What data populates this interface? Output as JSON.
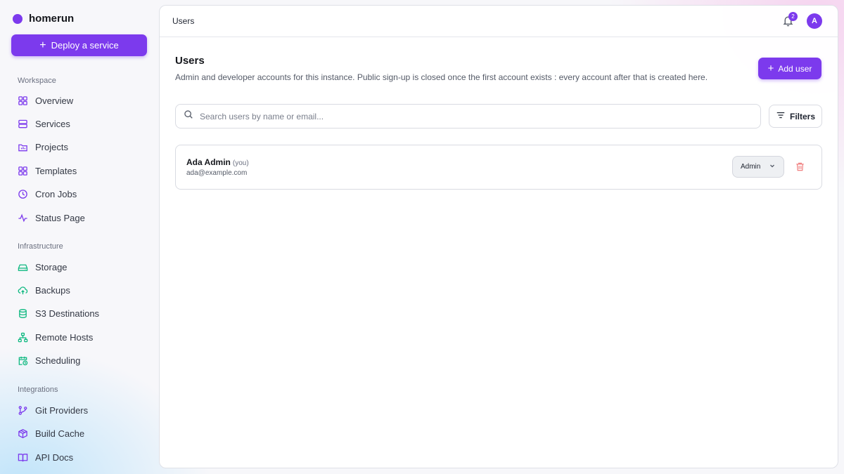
{
  "brand": {
    "name": "homerun",
    "accent": "#7c3aed"
  },
  "sidebar": {
    "deploy_label": "Deploy a service",
    "sections": [
      {
        "title": "Workspace",
        "items": [
          {
            "label": "Overview",
            "icon": "grid-icon"
          },
          {
            "label": "Services",
            "icon": "server-icon"
          },
          {
            "label": "Projects",
            "icon": "folder-icon"
          },
          {
            "label": "Templates",
            "icon": "template-grid-icon"
          },
          {
            "label": "Cron Jobs",
            "icon": "clock-icon"
          },
          {
            "label": "Status Page",
            "icon": "activity-icon"
          }
        ]
      },
      {
        "title": "Infrastructure",
        "items": [
          {
            "label": "Storage",
            "icon": "hard-drive-icon"
          },
          {
            "label": "Backups",
            "icon": "cloud-upload-icon"
          },
          {
            "label": "S3 Destinations",
            "icon": "database-icon"
          },
          {
            "label": "Remote Hosts",
            "icon": "network-icon"
          },
          {
            "label": "Scheduling",
            "icon": "calendar-clock-icon"
          }
        ]
      },
      {
        "title": "Integrations",
        "items": [
          {
            "label": "Git Providers",
            "icon": "git-branch-icon"
          },
          {
            "label": "Build Cache",
            "icon": "package-icon"
          },
          {
            "label": "API Docs",
            "icon": "book-icon"
          }
        ]
      }
    ]
  },
  "topbar": {
    "title": "Users",
    "notification_count": "2",
    "avatar_initial": "A"
  },
  "page": {
    "title": "Users",
    "description": "Admin and developer accounts for this instance. Public sign-up is closed once the first account exists : every account after that is created here.",
    "add_user_label": "Add user",
    "search_placeholder": "Search users by name or email...",
    "filters_label": "Filters"
  },
  "users": [
    {
      "name": "Ada Admin",
      "you_tag": "(you)",
      "email": "ada@example.com",
      "role": "Admin"
    }
  ],
  "colors": {
    "workspace_icon": "#7c3aed",
    "infrastructure_icon": "#10b981",
    "integrations_icon": "#7c3aed",
    "danger": "#f08080"
  }
}
